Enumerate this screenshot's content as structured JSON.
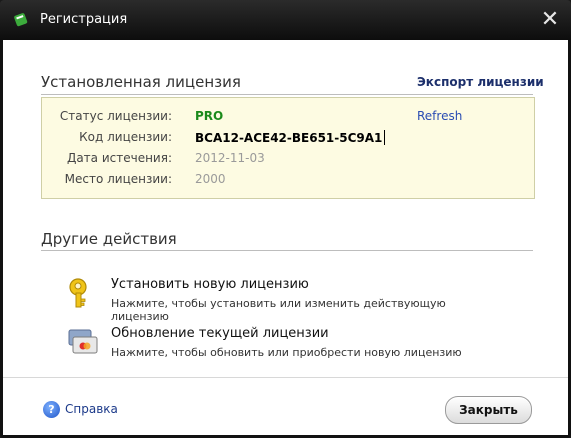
{
  "window": {
    "title": "Регистрация"
  },
  "installed": {
    "heading": "Установленная лицензия",
    "export_label": "Экспорт лицензии",
    "rows": [
      {
        "label": "Статус лицензии:",
        "value": "PRO"
      },
      {
        "label": "Код лицензии:",
        "value": "BCA12-ACE42-BE651-5C9A1"
      },
      {
        "label": "Дата истечения:",
        "value": "2012-11-03"
      },
      {
        "label": "Место лицензии:",
        "value": "2000"
      }
    ],
    "refresh_label": "Refresh"
  },
  "other": {
    "heading": "Другие действия",
    "actions": [
      {
        "title": "Установить новую лицензию",
        "desc": "Нажмите, чтобы установить или изменить действующую лицензию",
        "icon": "key-icon"
      },
      {
        "title": "Обновление текущей лицензии",
        "desc": "Нажмите, чтобы обновить или приобрести новую лицензию",
        "icon": "credit-card-icon"
      }
    ]
  },
  "footer": {
    "help_label": "Справка",
    "close_label": "Закрыть"
  },
  "colors": {
    "status_green": "#1b8a1b",
    "link_blue": "#2a4cb3",
    "info_bg": "#fdfbe2"
  }
}
